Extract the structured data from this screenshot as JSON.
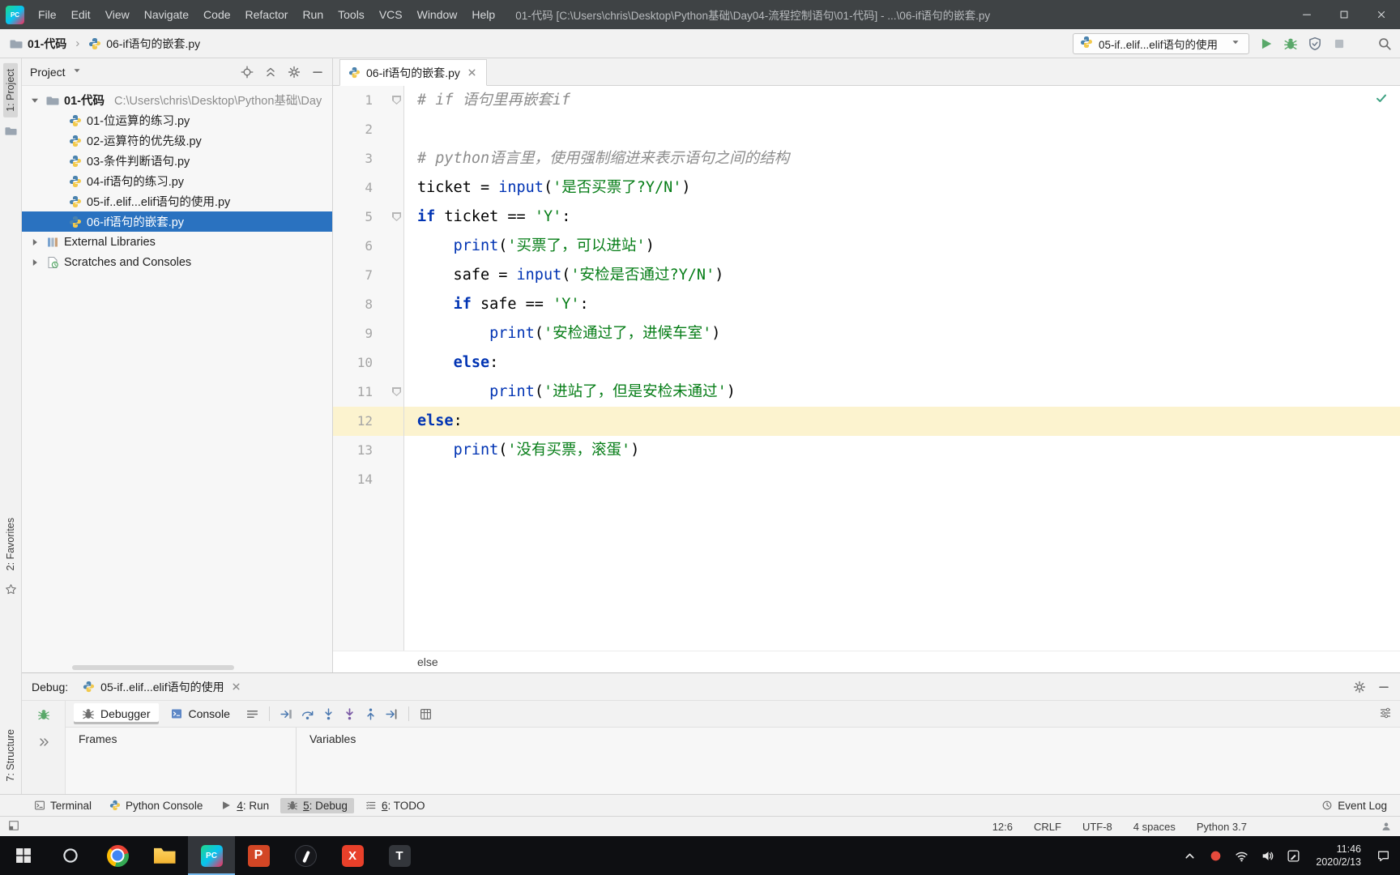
{
  "colors": {
    "title_bar_bg": "#3f4345",
    "selection_blue": "#2a72c0",
    "keyword": "#0033b3",
    "string": "#067d17",
    "comment": "#8c8c8c",
    "caret_line": "#fcf3cf",
    "run_green": "#59a869",
    "taskbar_bg": "#0e0f12"
  },
  "title_bar": {
    "logo_text": "PC",
    "menus": [
      "File",
      "Edit",
      "View",
      "Navigate",
      "Code",
      "Refactor",
      "Run",
      "Tools",
      "VCS",
      "Window",
      "Help"
    ],
    "title": "01-代码 [C:\\Users\\chris\\Desktop\\Python基础\\Day04-流程控制语句\\01-代码] - ...\\06-if语句的嵌套.py",
    "window_controls": [
      "minimize",
      "maximize",
      "close"
    ]
  },
  "nav_bar": {
    "breadcrumbs": [
      {
        "icon": "folder-icon",
        "label": "01-代码"
      },
      {
        "icon": "python-file-icon",
        "label": "06-if语句的嵌套.py"
      }
    ],
    "run_config": {
      "icon": "python-file-icon",
      "label": "05-if..elif...elif语句的使用"
    },
    "actions": [
      {
        "name": "run-button",
        "icon": "run-icon"
      },
      {
        "name": "debug-button",
        "icon": "debug-bug-icon"
      },
      {
        "name": "coverage-button",
        "icon": "coverage-icon"
      },
      {
        "name": "stop-button",
        "icon": "stop-icon"
      },
      {
        "name": "search-everywhere-button",
        "icon": "search-icon",
        "gap": true
      }
    ]
  },
  "left_stripe": {
    "project": "1: Project",
    "favorites": "2: Favorites",
    "structure": "7: Structure"
  },
  "project_panel": {
    "title": "Project",
    "header_icons": [
      {
        "name": "locate-button",
        "icon": "locate-icon"
      },
      {
        "name": "collapse-all-button",
        "icon": "collapse-icon"
      },
      {
        "name": "settings-button",
        "icon": "settings-gear-icon"
      },
      {
        "name": "hide-button",
        "icon": "hide-icon"
      }
    ],
    "tree": [
      {
        "kind": "root",
        "label": "01-代码",
        "path": "C:\\Users\\chris\\Desktop\\Python基础\\Day"
      },
      {
        "kind": "file",
        "label": "01-位运算的练习.py"
      },
      {
        "kind": "file",
        "label": "02-运算符的优先级.py"
      },
      {
        "kind": "file",
        "label": "03-条件判断语句.py"
      },
      {
        "kind": "file",
        "label": "04-if语句的练习.py"
      },
      {
        "kind": "file",
        "label": "05-if..elif...elif语句的使用.py"
      },
      {
        "kind": "file",
        "label": "06-if语句的嵌套.py",
        "selected": true
      },
      {
        "kind": "node",
        "label": "External Libraries",
        "icon": "libraries-icon",
        "collapsed": true
      },
      {
        "kind": "node",
        "label": "Scratches and Consoles",
        "icon": "scratches-icon",
        "collapsed": true
      }
    ]
  },
  "editor": {
    "tab": {
      "icon": "python-file-icon",
      "label": "06-if语句的嵌套.py"
    },
    "caret_line": 12,
    "fold_lines": [
      1,
      5,
      11
    ],
    "breadcrumb": "else",
    "lines": [
      {
        "no": 1,
        "tokens": [
          [
            "com",
            "# if 语句里再嵌套if"
          ]
        ]
      },
      {
        "no": 2,
        "tokens": []
      },
      {
        "no": 3,
        "tokens": [
          [
            "com",
            "# python语言里，使用强制缩进来表示语句之间的结构"
          ]
        ]
      },
      {
        "no": 4,
        "tokens": [
          [
            "plain",
            "ticket = "
          ],
          [
            "builtin",
            "input"
          ],
          [
            "plain",
            "("
          ],
          [
            "str",
            "'是否买票了?Y/N'"
          ],
          [
            "plain",
            ")"
          ]
        ]
      },
      {
        "no": 5,
        "tokens": [
          [
            "kw",
            "if"
          ],
          [
            "plain",
            " ticket == "
          ],
          [
            "str",
            "'Y'"
          ],
          [
            "plain",
            ":"
          ]
        ]
      },
      {
        "no": 6,
        "tokens": [
          [
            "plain",
            "    "
          ],
          [
            "builtin",
            "print"
          ],
          [
            "plain",
            "("
          ],
          [
            "str",
            "'买票了，可以进站'"
          ],
          [
            "plain",
            ")"
          ]
        ]
      },
      {
        "no": 7,
        "tokens": [
          [
            "plain",
            "    safe = "
          ],
          [
            "builtin",
            "input"
          ],
          [
            "plain",
            "("
          ],
          [
            "str",
            "'安检是否通过?Y/N'"
          ],
          [
            "plain",
            ")"
          ]
        ]
      },
      {
        "no": 8,
        "tokens": [
          [
            "plain",
            "    "
          ],
          [
            "kw",
            "if"
          ],
          [
            "plain",
            " safe == "
          ],
          [
            "str",
            "'Y'"
          ],
          [
            "plain",
            ":"
          ]
        ]
      },
      {
        "no": 9,
        "tokens": [
          [
            "plain",
            "        "
          ],
          [
            "builtin",
            "print"
          ],
          [
            "plain",
            "("
          ],
          [
            "str",
            "'安检通过了，进候车室'"
          ],
          [
            "plain",
            ")"
          ]
        ]
      },
      {
        "no": 10,
        "tokens": [
          [
            "plain",
            "    "
          ],
          [
            "kw",
            "else"
          ],
          [
            "plain",
            ":"
          ]
        ]
      },
      {
        "no": 11,
        "tokens": [
          [
            "plain",
            "        "
          ],
          [
            "builtin",
            "print"
          ],
          [
            "plain",
            "("
          ],
          [
            "str",
            "'进站了，但是安检未通过'"
          ],
          [
            "plain",
            ")"
          ]
        ]
      },
      {
        "no": 12,
        "tokens": [
          [
            "kw",
            "else"
          ],
          [
            "plain",
            ":"
          ]
        ]
      },
      {
        "no": 13,
        "tokens": [
          [
            "plain",
            "    "
          ],
          [
            "builtin",
            "print"
          ],
          [
            "plain",
            "("
          ],
          [
            "str",
            "'没有买票，滚蛋'"
          ],
          [
            "plain",
            ")"
          ]
        ]
      },
      {
        "no": 14,
        "tokens": []
      }
    ]
  },
  "debug_panel": {
    "label": "Debug:",
    "session_tab": {
      "icon": "python-file-icon",
      "label": "05-if..elif...elif语句的使用"
    },
    "header_icons": [
      {
        "name": "debug-settings-button",
        "icon": "settings-gear-icon"
      },
      {
        "name": "debug-hide-button",
        "icon": "hide-icon"
      }
    ],
    "tabs": [
      {
        "label": "Debugger",
        "icon": "debug-gray-icon",
        "active": true
      },
      {
        "label": "Console",
        "icon": "console-tab-icon",
        "active": false
      }
    ],
    "toolbar_icons": [
      "layout-icon",
      "|",
      "show-execution-point-icon",
      "step-over-icon",
      "step-into-icon",
      "force-step-into-icon",
      "step-out-icon",
      "run-to-cursor-icon",
      "|",
      "evaluate-icon"
    ],
    "sections": [
      {
        "title": "Frames"
      },
      {
        "title": "Variables"
      }
    ]
  },
  "tool_buttons": {
    "left": [
      {
        "text": "Terminal",
        "icon": "terminal-icon"
      },
      {
        "text": "Python Console",
        "icon": "python-console-icon"
      },
      {
        "text": "Run",
        "mnemonic": "4",
        "icon": "run-gray-icon"
      },
      {
        "text": "Debug",
        "mnemonic": "5",
        "icon": "debug-gray-icon",
        "active": true
      },
      {
        "text": "TODO",
        "mnemonic": "6",
        "icon": "todo-icon"
      }
    ],
    "right": [
      {
        "text": "Event Log",
        "icon": "event-log-icon"
      }
    ]
  },
  "status_bar": {
    "items": [
      "12:6",
      "CRLF",
      "UTF-8",
      "4 spaces",
      "Python 3.7"
    ]
  },
  "taskbar": {
    "apps": [
      {
        "name": "start",
        "icon": "start-icon"
      },
      {
        "name": "cortana",
        "icon": "cortana-icon"
      },
      {
        "name": "chrome"
      },
      {
        "name": "explorer"
      },
      {
        "name": "pycharm",
        "glyph": "PC",
        "active": true
      },
      {
        "name": "powerpoint",
        "glyph": "P"
      },
      {
        "name": "roundapp"
      },
      {
        "name": "redapp",
        "glyph": "X"
      },
      {
        "name": "typora",
        "glyph": "T"
      }
    ],
    "tray": [
      {
        "name": "tray-expand-button",
        "icon": "tray-expand-icon"
      },
      {
        "name": "tray-red-app",
        "icon": "tray-red-icon"
      },
      {
        "name": "network-status",
        "icon": "network-icon"
      },
      {
        "name": "volume-control",
        "icon": "volume-icon"
      },
      {
        "name": "windows-ink",
        "icon": "ink-icon"
      }
    ],
    "time": "11:46",
    "date": "2020/2/13"
  }
}
